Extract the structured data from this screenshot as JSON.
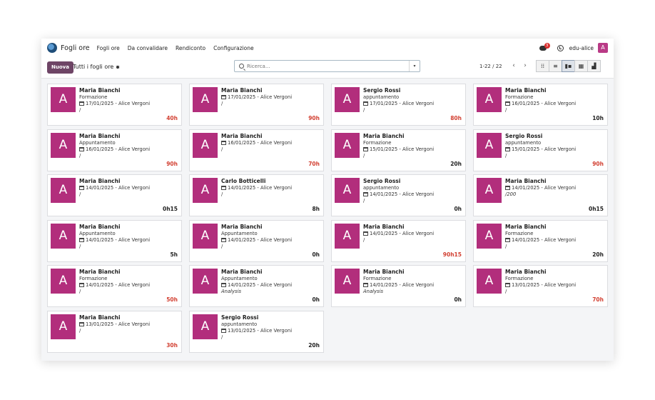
{
  "navbar": {
    "app_title": "Fogli ore",
    "menu": [
      "Fogli ore",
      "Da convalidare",
      "Rendiconto",
      "Configurazione"
    ],
    "notification_count": "3",
    "user_name": "edu-alice",
    "user_initial": "A"
  },
  "control_panel": {
    "new_button": "Nuova",
    "breadcrumb": "Tutti i fogli ore",
    "search_placeholder": "Ricerca...",
    "pager": "1-22 / 22",
    "prev": "‹",
    "next": "›",
    "dropdown_icon": "▾"
  },
  "colors": {
    "avatar": "#b22e7c",
    "brand": "#6e4566",
    "hours_red": "#d23f31"
  },
  "cards": [
    {
      "initial": "A",
      "name": "Maria Bianchi",
      "type": "Formazione",
      "date": "17/01/2025 - Alice Vergoni",
      "desc": "/",
      "hours": "40h",
      "red": true
    },
    {
      "initial": "A",
      "name": "Maria Bianchi",
      "type": "",
      "date": "17/01/2025 - Alice Vergoni",
      "desc": "/",
      "hours": "90h",
      "red": true
    },
    {
      "initial": "A",
      "name": "Sergio Rossi",
      "type": "appuntamento",
      "date": "17/01/2025 - Alice Vergoni",
      "desc": "/",
      "hours": "80h",
      "red": true
    },
    {
      "initial": "A",
      "name": "Maria Bianchi",
      "type": "Formazione",
      "date": "16/01/2025 - Alice Vergoni",
      "desc": "/",
      "hours": "10h",
      "red": false
    },
    {
      "initial": "A",
      "name": "Maria Bianchi",
      "type": "Appuntamento",
      "date": "16/01/2025 - Alice Vergoni",
      "desc": "/",
      "hours": "90h",
      "red": true
    },
    {
      "initial": "A",
      "name": "Maria Bianchi",
      "type": "",
      "date": "16/01/2025 - Alice Vergoni",
      "desc": "/",
      "hours": "70h",
      "red": true
    },
    {
      "initial": "A",
      "name": "Maria Bianchi",
      "type": "Formazione",
      "date": "15/01/2025 - Alice Vergoni",
      "desc": "/",
      "hours": "20h",
      "red": false
    },
    {
      "initial": "A",
      "name": "Sergio Rossi",
      "type": "appuntamento",
      "date": "15/01/2025 - Alice Vergoni",
      "desc": "/",
      "hours": "90h",
      "red": true
    },
    {
      "initial": "A",
      "name": "Maria Bianchi",
      "type": "",
      "date": "14/01/2025 - Alice Vergoni",
      "desc": "/",
      "hours": "0h15",
      "red": false
    },
    {
      "initial": "A",
      "name": "Carlo Botticelli",
      "type": "",
      "date": "14/01/2025 - Alice Vergoni",
      "desc": "/",
      "hours": "8h",
      "red": false
    },
    {
      "initial": "A",
      "name": "Sergio Rossi",
      "type": "appuntamento",
      "date": "14/01/2025 - Alice Vergoni",
      "desc": "/",
      "hours": "0h",
      "red": false
    },
    {
      "initial": "A",
      "name": "Maria Bianchi",
      "type": "",
      "date": "14/01/2025 - Alice Vergoni",
      "desc": "/200",
      "hours": "0h15",
      "red": false
    },
    {
      "initial": "A",
      "name": "Maria Bianchi",
      "type": "Appuntamento",
      "date": "14/01/2025 - Alice Vergoni",
      "desc": "/",
      "hours": "5h",
      "red": false
    },
    {
      "initial": "A",
      "name": "Maria Bianchi",
      "type": "Appuntamento",
      "date": "14/01/2025 - Alice Vergoni",
      "desc": "/",
      "hours": "0h",
      "red": false
    },
    {
      "initial": "A",
      "name": "Maria Bianchi",
      "type": "",
      "date": "14/01/2025 - Alice Vergoni",
      "desc": "/",
      "hours": "90h15",
      "red": true
    },
    {
      "initial": "A",
      "name": "Maria Bianchi",
      "type": "Formazione",
      "date": "14/01/2025 - Alice Vergoni",
      "desc": "/",
      "hours": "20h",
      "red": false
    },
    {
      "initial": "A",
      "name": "Maria Bianchi",
      "type": "Formazione",
      "date": "14/01/2025 - Alice Vergoni",
      "desc": "/",
      "hours": "50h",
      "red": true
    },
    {
      "initial": "A",
      "name": "Maria Bianchi",
      "type": "Appuntamento",
      "date": "14/01/2025 - Alice Vergoni",
      "desc": "Analysis",
      "hours": "0h",
      "red": false
    },
    {
      "initial": "A",
      "name": "Maria Bianchi",
      "type": "Formazione",
      "date": "14/01/2025 - Alice Vergoni",
      "desc": "Analysis",
      "hours": "0h",
      "red": false
    },
    {
      "initial": "A",
      "name": "Maria Bianchi",
      "type": "Formazione",
      "date": "13/01/2025 - Alice Vergoni",
      "desc": "/",
      "hours": "70h",
      "red": true
    },
    {
      "initial": "A",
      "name": "Maria Bianchi",
      "type": "",
      "date": "13/01/2025 - Alice Vergoni",
      "desc": "/",
      "hours": "30h",
      "red": true
    },
    {
      "initial": "A",
      "name": "Sergio Rossi",
      "type": "appuntamento",
      "date": "13/01/2025 - Alice Vergoni",
      "desc": "/",
      "hours": "20h",
      "red": false
    }
  ]
}
